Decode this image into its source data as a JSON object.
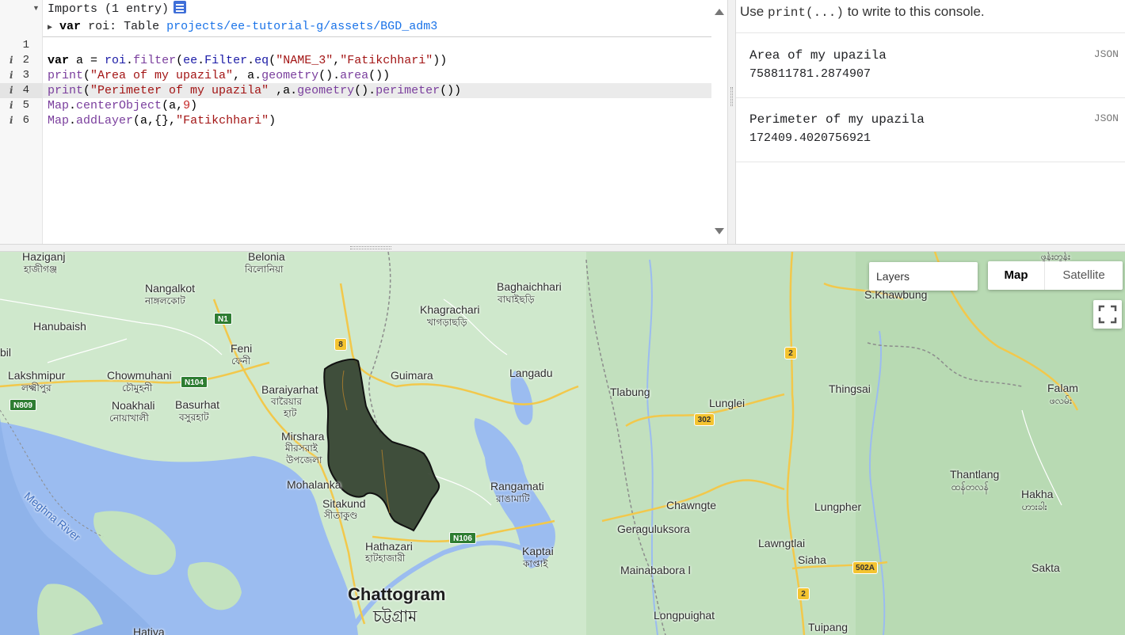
{
  "editor": {
    "imports_header": "Imports (1 entry)",
    "import_entry": {
      "keyword": "var",
      "name": "roi",
      "type": "Table",
      "path": "projects/ee-tutorial-g/assets/BGD_adm3"
    },
    "line_numbers": [
      "1",
      "2",
      "3",
      "4",
      "5",
      "6"
    ],
    "info_marker": "i",
    "code": {
      "line2": {
        "kw": "var",
        "a": " a = ",
        "roi": "roi",
        "dot1": ".",
        "filter": "filter",
        "p1": "(",
        "ee": "ee",
        "dot2": ".",
        "Filter": "Filter",
        "dot3": ".",
        "eq": "eq",
        "p2": "(",
        "s1": "\"NAME_3\"",
        "comma": ",",
        "s2": "\"Fatikchhari\"",
        "end": "))"
      },
      "line3": {
        "print": "print",
        "p1": "(",
        "s": "\"Area of my upazila\"",
        "mid": ", a.",
        "geometry": "geometry",
        "mid2": "().",
        "area": "area",
        "end": "())"
      },
      "line4": {
        "print": "print",
        "p1": "(",
        "s": "\"Perimeter of my upazila\"",
        "mid": " ,a.",
        "geometry": "geometry",
        "mid2": "().",
        "perimeter": "perimeter",
        "end": "())"
      },
      "line5": {
        "map": "Map",
        "dot": ".",
        "fn": "centerObject",
        "mid": "(a,",
        "num": "9",
        "end": ")"
      },
      "line6": {
        "map": "Map",
        "dot": ".",
        "fn": "addLayer",
        "mid": "(a,{},",
        "s": "\"Fatikchhari\"",
        "end": ")"
      }
    }
  },
  "console": {
    "hint_prefix": "Use ",
    "hint_code": "print(...)",
    "hint_suffix": " to write to this console.",
    "entries": [
      {
        "label": "Area of my upazila",
        "value": "758811781.2874907",
        "json_label": "JSON"
      },
      {
        "label": "Perimeter of my upazila",
        "value": "172409.4020756921",
        "json_label": "JSON"
      }
    ]
  },
  "map": {
    "layers_label": "Layers",
    "map_type_buttons": [
      "Map",
      "Satellite"
    ],
    "colors": {
      "water": "#9bbcf0",
      "land": "#cfe8cc",
      "region_fill": "#33402f",
      "region_stroke": "#111111"
    },
    "places": {
      "haziganj": "Haziganj",
      "haziganj_bn": "হাজীগঞ্জ",
      "belonia": "Belonia",
      "belonia_bn": "বিলোনিয়া",
      "nangalkot": "Nangalkot",
      "nangalkot_bn": "নাঙ্গলকোট",
      "hanubaish": "Hanubaish",
      "bil": "bil",
      "feni": "Feni",
      "feni_bn": "ফেনী",
      "lakshmipur": "Lakshmipur",
      "lakshmipur_bn": "লক্ষ্মীপুর",
      "chowmuhani": "Chowmuhani",
      "chowmuhani_bn": "চৌমুহনী",
      "noakhali": "Noakhali",
      "noakhali_bn": "নোয়াখালী",
      "basurhat": "Basurhat",
      "basurhat_bn": "বসুরহাট",
      "baraiyarhat": "Baraiyarhat",
      "baraiyarhat_bn1": "বারৈয়ার",
      "baraiyarhat_bn2": "হাট",
      "mirshara": "Mirshara",
      "mirshara_bn1": "মীরসরাই",
      "mirshara_bn2": "উপজেলা",
      "mohalanka": "Mohalanka",
      "sitakund": "Sitakund",
      "sitakund_bn": "সীতাকুণ্ড",
      "hathazari": "Hathazari",
      "hathazari_bn": "হাটহাজারী",
      "chattogram": "Chattogram",
      "chattogram_bn": "চট্টগ্রাম",
      "hatiya": "Hatiya",
      "meghna": "Meghna River",
      "baghaichhari": "Baghaichhari",
      "baghaichhari_bn": "বাঘাইছড়ি",
      "khagrachari": "Khagrachari",
      "khagrachari_bn": "খাগড়াছড়ি",
      "guimara": "Guimara",
      "langadu": "Langadu",
      "rangamati": "Rangamati",
      "rangamati_bn": "রাঙামাটি",
      "kaptai": "Kaptai",
      "kaptai_bn": "কাপ্তাই",
      "tlabung": "Tlabung",
      "lunglei": "Lunglei",
      "chawngte": "Chawngte",
      "geraguluksora": "Geraguluksora",
      "mainababora": "Mainababora l",
      "longpuighat": "Longpuighat",
      "s_khawbung": "S.Khawbung",
      "thingsai": "Thingsai",
      "lungpher": "Lungpher",
      "lawngtlai": "Lawngtlai",
      "siaha": "Siaha",
      "tuipang": "Tuipang",
      "falam": "Falam",
      "falam_my": "ဖလမ်း",
      "thantlang": "Thantlang",
      "thantlang_my": "ထန်တလန်",
      "hakha": "Hakha",
      "hakha_my": "ဟားခါး",
      "sakta": "Sakta",
      "top_right_my": "ဖွန်းတွန်း"
    },
    "roads": {
      "n1": "N1",
      "n104": "N104",
      "n809": "N809",
      "n106": "N106",
      "r8": "8",
      "r2a": "2",
      "r2b": "2",
      "r302": "302",
      "r502a": "502A"
    }
  }
}
